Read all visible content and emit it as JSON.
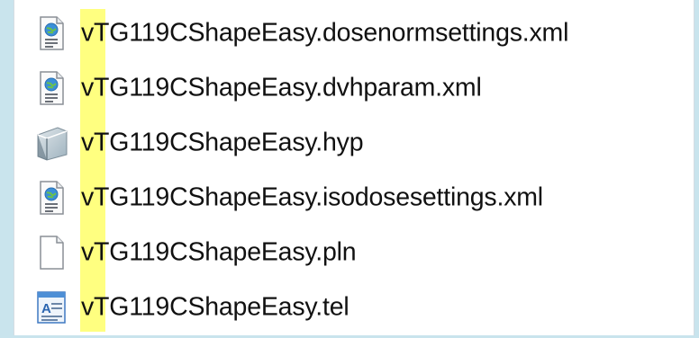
{
  "files": [
    {
      "name": "vTG119CShapeEasy.dosenormsettings.xml",
      "icon": "xml-document-icon"
    },
    {
      "name": "vTG119CShapeEasy.dvhparam.xml",
      "icon": "xml-document-icon"
    },
    {
      "name": "vTG119CShapeEasy.hyp",
      "icon": "hyp-document-icon"
    },
    {
      "name": "vTG119CShapeEasy.isodosesettings.xml",
      "icon": "xml-document-icon"
    },
    {
      "name": "vTG119CShapeEasy.pln",
      "icon": "blank-document-icon"
    },
    {
      "name": "vTG119CShapeEasy.tel",
      "icon": "text-document-icon"
    }
  ],
  "colors": {
    "background": "#c9e4ed",
    "panel": "#ffffff",
    "highlight": "#ffff80",
    "text": "#111111"
  }
}
